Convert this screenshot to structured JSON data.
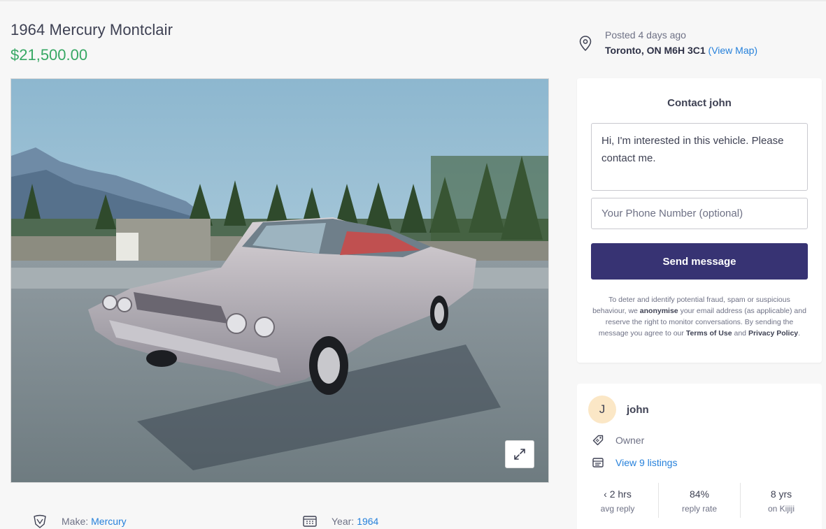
{
  "listing": {
    "title": "1964 Mercury Montclair",
    "price": "$21,500.00"
  },
  "meta": {
    "posted": "Posted 4 days ago",
    "location": "Toronto, ON M6H 3C1",
    "view_map": "(View Map)",
    "icon": "location-pin-icon"
  },
  "contact": {
    "heading": "Contact john",
    "message": "Hi, I'm interested in this vehicle. Please contact me.",
    "phone_placeholder": "Your Phone Number (optional)",
    "send_label": "Send message",
    "disclaimer": {
      "p1": "To deter and identify potential fraud, spam or suspicious behaviour, we ",
      "b1": "anonymise",
      "p2": " your email address (as applicable) and reserve the right to monitor conversations. By sending the message you agree to our ",
      "terms": "Terms of Use",
      "p3": " and ",
      "privacy": "Privacy Policy",
      "p4": "."
    }
  },
  "seller": {
    "initial": "J",
    "name": "john",
    "type": "Owner",
    "listings_link": "View 9 listings",
    "stats": [
      {
        "value": "‹ 2 hrs",
        "label": "avg reply"
      },
      {
        "value": "84%",
        "label": "reply rate"
      },
      {
        "value": "8 yrs",
        "label": "on Kijiji"
      }
    ]
  },
  "attributes": {
    "make_label": "Make:",
    "make_value": "Mercury",
    "year_label": "Year:",
    "year_value": "1964"
  },
  "colors": {
    "brand": "#373373",
    "price": "#37a864",
    "link": "#2681db"
  }
}
